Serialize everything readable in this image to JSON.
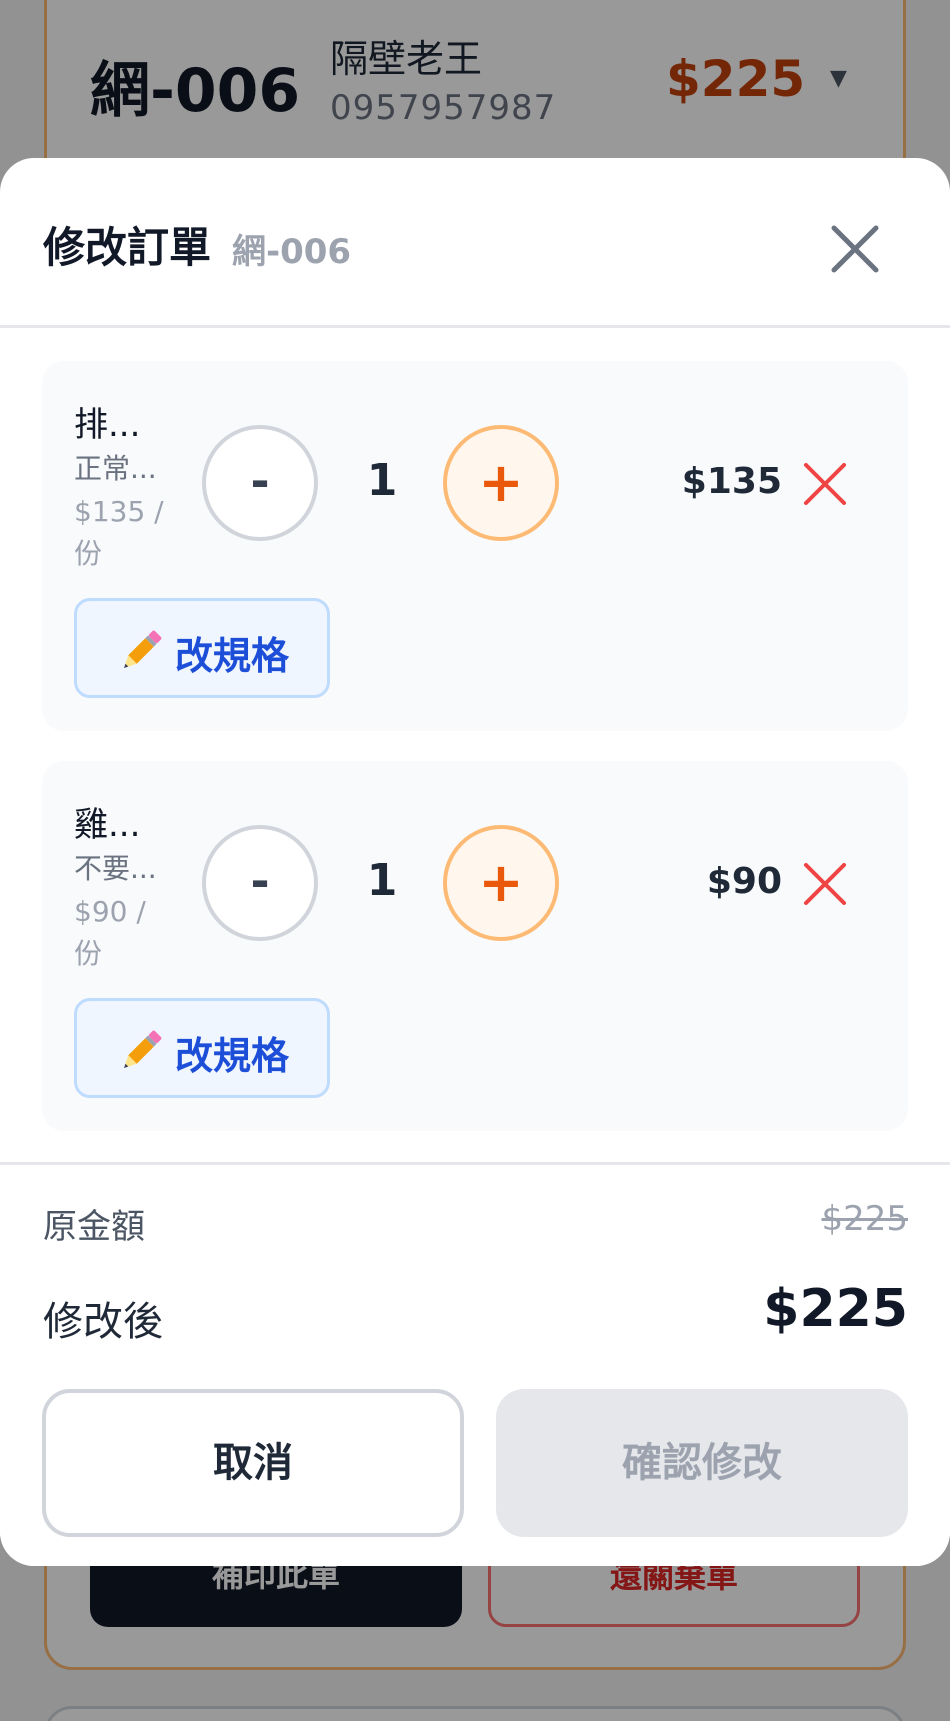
{
  "background": {
    "order_no": "網-006",
    "customer_name": "隔壁老王",
    "customer_phone": "0957957987",
    "amount": "$225",
    "print_label": "補印此單",
    "void_label": "還關棄單"
  },
  "modal": {
    "title": "修改訂單",
    "order_no": "網-006"
  },
  "items": [
    {
      "name": "排...",
      "option": "正常...",
      "unit_price": "$135 / 份",
      "minus_label": "-",
      "qty": "1",
      "plus_label": "+",
      "total": "$135",
      "spec_label": "改規格"
    },
    {
      "name": "雞...",
      "option": "不要...",
      "unit_price": "$90 / 份",
      "minus_label": "-",
      "qty": "1",
      "plus_label": "+",
      "total": "$90",
      "spec_label": "改規格"
    }
  ],
  "summary": {
    "original_label": "原金額",
    "original_value": "$225",
    "new_label": "修改後",
    "new_value": "$225"
  },
  "actions": {
    "cancel_label": "取消",
    "confirm_label": "確認修改",
    "confirm_enabled": false
  },
  "colors": {
    "accent_orange": "#ea580c",
    "remove_red": "#ef4444",
    "spec_blue": "#1d4ed8"
  },
  "icons": {
    "close": "close-icon",
    "remove": "x-icon",
    "spec": "pencil-icon"
  }
}
